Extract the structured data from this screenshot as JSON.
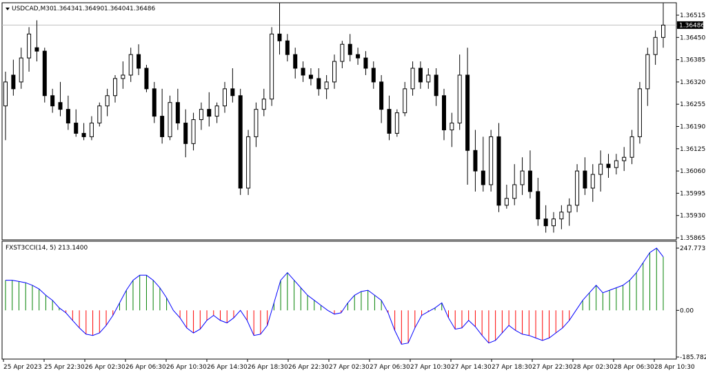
{
  "main": {
    "symbol_timeframe": "USDCAD,M30",
    "ohlc": [
      "1.36434",
      "1.36490",
      "1.36404",
      "1.36486"
    ],
    "current_price": "1.36486"
  },
  "indicator": {
    "label": "FXST3CCI(14, 5) 213.1400",
    "up_color": "#008000",
    "down_color": "#ff0000",
    "line_color": "#0000ff"
  },
  "chart_data": [
    {
      "type": "candlestick",
      "title": "USDCAD,M30",
      "y_ticks": [
        "1.36515",
        "1.36450",
        "1.36385",
        "1.36320",
        "1.36255",
        "1.36190",
        "1.36125",
        "1.36060",
        "1.35995",
        "1.35930",
        "1.35865"
      ],
      "ylim": [
        1.35865,
        1.3656
      ],
      "current_price": 1.36486,
      "candles": [
        [
          1.3625,
          1.3635,
          1.3615,
          1.3632
        ],
        [
          1.3634,
          1.36385,
          1.3628,
          1.363
        ],
        [
          1.3632,
          1.3642,
          1.363,
          1.3639
        ],
        [
          1.3639,
          1.3648,
          1.3635,
          1.3646
        ],
        [
          1.3642,
          1.365,
          1.3638,
          1.3641
        ],
        [
          1.3641,
          1.3642,
          1.3626,
          1.3628
        ],
        [
          1.3628,
          1.363,
          1.3623,
          1.3625
        ],
        [
          1.3626,
          1.3632,
          1.3622,
          1.3624
        ],
        [
          1.3624,
          1.3628,
          1.3618,
          1.362
        ],
        [
          1.362,
          1.3624,
          1.3616,
          1.3617
        ],
        [
          1.3617,
          1.362,
          1.3615,
          1.3616
        ],
        [
          1.3616,
          1.3622,
          1.3615,
          1.362
        ],
        [
          1.362,
          1.3626,
          1.3619,
          1.3625
        ],
        [
          1.3625,
          1.363,
          1.3622,
          1.3628
        ],
        [
          1.3628,
          1.3634,
          1.3626,
          1.3633
        ],
        [
          1.3633,
          1.3638,
          1.363,
          1.3634
        ],
        [
          1.3634,
          1.3642,
          1.3632,
          1.364
        ],
        [
          1.364,
          1.3643,
          1.3634,
          1.3636
        ],
        [
          1.3636,
          1.3637,
          1.3629,
          1.363
        ],
        [
          1.363,
          1.3632,
          1.362,
          1.3622
        ],
        [
          1.3622,
          1.363,
          1.3614,
          1.3616
        ],
        [
          1.3616,
          1.3628,
          1.3615,
          1.3626
        ],
        [
          1.3626,
          1.363,
          1.3618,
          1.362
        ],
        [
          1.362,
          1.3624,
          1.361,
          1.3614
        ],
        [
          1.3614,
          1.3623,
          1.3612,
          1.3621
        ],
        [
          1.3621,
          1.3626,
          1.3618,
          1.3624
        ],
        [
          1.3624,
          1.3629,
          1.3619,
          1.3622
        ],
        [
          1.3622,
          1.3626,
          1.362,
          1.3625
        ],
        [
          1.3625,
          1.3632,
          1.3623,
          1.363
        ],
        [
          1.363,
          1.3636,
          1.3626,
          1.3628
        ],
        [
          1.3628,
          1.363,
          1.3599,
          1.3601
        ],
        [
          1.3601,
          1.3618,
          1.3599,
          1.3616
        ],
        [
          1.3616,
          1.3626,
          1.3613,
          1.3624
        ],
        [
          1.3624,
          1.363,
          1.3622,
          1.3627
        ],
        [
          1.3627,
          1.3648,
          1.3625,
          1.3646
        ],
        [
          1.3646,
          1.3655,
          1.364,
          1.3644
        ],
        [
          1.3644,
          1.3646,
          1.3638,
          1.364
        ],
        [
          1.364,
          1.3642,
          1.3633,
          1.3636
        ],
        [
          1.3636,
          1.3638,
          1.3632,
          1.3634
        ],
        [
          1.3634,
          1.3636,
          1.3631,
          1.3633
        ],
        [
          1.3633,
          1.3636,
          1.3628,
          1.363
        ],
        [
          1.363,
          1.3634,
          1.3627,
          1.3632
        ],
        [
          1.3632,
          1.364,
          1.363,
          1.3638
        ],
        [
          1.3638,
          1.3644,
          1.3636,
          1.3643
        ],
        [
          1.3643,
          1.3646,
          1.3638,
          1.364
        ],
        [
          1.364,
          1.3642,
          1.3637,
          1.3639
        ],
        [
          1.3639,
          1.3641,
          1.3634,
          1.3636
        ],
        [
          1.3636,
          1.3638,
          1.363,
          1.3632
        ],
        [
          1.3632,
          1.3634,
          1.362,
          1.3624
        ],
        [
          1.3624,
          1.3628,
          1.3615,
          1.3617
        ],
        [
          1.3617,
          1.3624,
          1.3616,
          1.3623
        ],
        [
          1.3623,
          1.3632,
          1.3622,
          1.363
        ],
        [
          1.363,
          1.3638,
          1.3628,
          1.3636
        ],
        [
          1.3636,
          1.3638,
          1.363,
          1.3632
        ],
        [
          1.3632,
          1.3636,
          1.363,
          1.3634
        ],
        [
          1.3634,
          1.3636,
          1.3625,
          1.3628
        ],
        [
          1.3628,
          1.363,
          1.3615,
          1.3618
        ],
        [
          1.3618,
          1.3623,
          1.3613,
          1.362
        ],
        [
          1.362,
          1.364,
          1.3618,
          1.3634
        ],
        [
          1.3634,
          1.3642,
          1.3602,
          1.3612
        ],
        [
          1.3612,
          1.3618,
          1.36,
          1.3606
        ],
        [
          1.3606,
          1.3616,
          1.36,
          1.3602
        ],
        [
          1.3602,
          1.3618,
          1.36,
          1.3616
        ],
        [
          1.3616,
          1.362,
          1.3594,
          1.3596
        ],
        [
          1.3596,
          1.3602,
          1.3595,
          1.3598
        ],
        [
          1.3598,
          1.3608,
          1.3596,
          1.3602
        ],
        [
          1.3602,
          1.361,
          1.3599,
          1.3606
        ],
        [
          1.3606,
          1.3612,
          1.3598,
          1.36
        ],
        [
          1.36,
          1.3604,
          1.359,
          1.3592
        ],
        [
          1.3592,
          1.3596,
          1.3588,
          1.359
        ],
        [
          1.359,
          1.3594,
          1.3588,
          1.3592
        ],
        [
          1.3592,
          1.3596,
          1.3589,
          1.3594
        ],
        [
          1.3594,
          1.3598,
          1.359,
          1.3596
        ],
        [
          1.3596,
          1.3608,
          1.3594,
          1.3606
        ],
        [
          1.3606,
          1.361,
          1.3599,
          1.3601
        ],
        [
          1.3601,
          1.3608,
          1.3597,
          1.3605
        ],
        [
          1.3605,
          1.3612,
          1.36,
          1.3608
        ],
        [
          1.3608,
          1.3611,
          1.3604,
          1.3607
        ],
        [
          1.3607,
          1.3611,
          1.3605,
          1.3609
        ],
        [
          1.3609,
          1.3613,
          1.3606,
          1.361
        ],
        [
          1.361,
          1.3618,
          1.3608,
          1.3616
        ],
        [
          1.3616,
          1.3632,
          1.3614,
          1.363
        ],
        [
          1.363,
          1.3642,
          1.3625,
          1.364
        ],
        [
          1.364,
          1.3647,
          1.3637,
          1.3645
        ],
        [
          1.3645,
          1.3655,
          1.3642,
          1.36486
        ]
      ]
    },
    {
      "type": "bar",
      "title": "FXST3CCI(14, 5) 213.1400",
      "y_ticks": [
        "247.7737",
        "0.00",
        "-185.782"
      ],
      "ylim": [
        -185.782,
        247.7737
      ],
      "values": [
        120,
        120,
        115,
        110,
        100,
        85,
        60,
        40,
        10,
        -10,
        -40,
        -70,
        -95,
        -100,
        -90,
        -60,
        -20,
        30,
        80,
        120,
        140,
        140,
        120,
        90,
        50,
        0,
        -30,
        -70,
        -90,
        -75,
        -40,
        -20,
        -40,
        -50,
        -30,
        0,
        -40,
        -100,
        -95,
        -60,
        30,
        120,
        150,
        120,
        90,
        60,
        40,
        20,
        0,
        -15,
        -10,
        30,
        60,
        75,
        80,
        60,
        40,
        -10,
        -80,
        -135,
        -130,
        -70,
        -20,
        -5,
        10,
        30,
        -30,
        -75,
        -70,
        -40,
        -65,
        -100,
        -130,
        -120,
        -90,
        -60,
        -80,
        -95,
        -100,
        -110,
        -120,
        -110,
        -90,
        -70,
        -40,
        0,
        40,
        70,
        100,
        70,
        80,
        90,
        100,
        120,
        150,
        190,
        230,
        248,
        213
      ]
    }
  ],
  "time_axis": {
    "labels": [
      "25 Apr 2023",
      "25 Apr 22:30",
      "26 Apr 02:30",
      "26 Apr 06:30",
      "26 Apr 10:30",
      "26 Apr 14:30",
      "26 Apr 18:30",
      "26 Apr 22:30",
      "27 Apr 02:30",
      "27 Apr 06:30",
      "27 Apr 10:30",
      "27 Apr 14:30",
      "27 Apr 18:30",
      "27 Apr 22:30",
      "28 Apr 02:30",
      "28 Apr 06:30",
      "28 Apr 10:30"
    ]
  }
}
